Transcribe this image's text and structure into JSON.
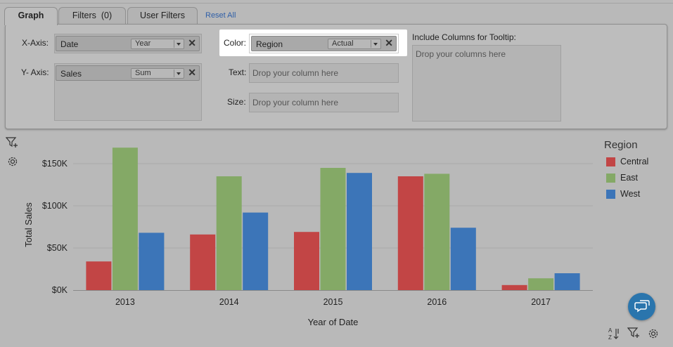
{
  "tabs": [
    {
      "label": "Graph",
      "active": true
    },
    {
      "label": "Filters  (0)",
      "active": false
    },
    {
      "label": "User Filters",
      "active": false
    }
  ],
  "reset_label": "Reset All",
  "shelf": {
    "x_axis": {
      "label": "X-Axis:",
      "field": "Date",
      "aggregation": "Year"
    },
    "y_axis": {
      "label": "Y- Axis:",
      "field": "Sales",
      "aggregation": "Sum"
    },
    "color": {
      "label": "Color:",
      "field": "Region",
      "aggregation": "Actual"
    },
    "text": {
      "label": "Text:",
      "placeholder": "Drop your column here"
    },
    "size": {
      "label": "Size:",
      "placeholder": "Drop your column here"
    },
    "tooltip": {
      "label": "Include Columns for Tooltip:",
      "placeholder": "Drop your columns here"
    }
  },
  "icons": {
    "filter_add": "filter-add-icon",
    "settings": "gear-icon",
    "sort": "sort-az-icon",
    "chat": "chat-icon"
  },
  "colors": {
    "Central": "#c24545",
    "East": "#84a966",
    "West": "#3c75b8"
  },
  "chart_data": {
    "type": "bar",
    "categories": [
      "2013",
      "2014",
      "2015",
      "2016",
      "2017"
    ],
    "series": [
      {
        "name": "Central",
        "values": [
          34000,
          66000,
          69000,
          135000,
          6000
        ]
      },
      {
        "name": "East",
        "values": [
          169000,
          135000,
          145000,
          138000,
          14000
        ]
      },
      {
        "name": "West",
        "values": [
          68000,
          92000,
          139000,
          74000,
          20000
        ]
      }
    ],
    "xlabel": "Year of Date",
    "ylabel": "Total Sales",
    "yticks": [
      "$0K",
      "$50K",
      "$100K",
      "$150K"
    ],
    "ytick_values": [
      0,
      50000,
      100000,
      150000
    ],
    "ylim": [
      0,
      180000
    ],
    "grid": true,
    "legend": {
      "title": "Region",
      "placement": "right"
    }
  }
}
